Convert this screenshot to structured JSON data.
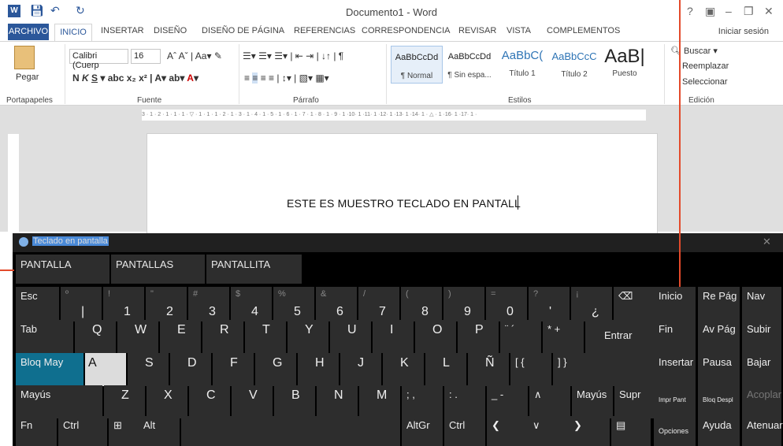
{
  "titlebar": {
    "document_title": "Documento1 - Word",
    "controls": [
      "?",
      "▣",
      "–",
      "❐",
      "✕"
    ]
  },
  "tabs": {
    "archivo": "ARCHIVO",
    "inicio": "INICIO",
    "items": [
      "INSERTAR",
      "DISEÑO",
      "DISEÑO DE PÁGINA",
      "REFERENCIAS",
      "CORRESPONDENCIA",
      "REVISAR",
      "VISTA",
      "COMPLEMENTOS"
    ],
    "signin": "Iniciar sesión"
  },
  "ribbon": {
    "paste_label": "Pegar",
    "font_name": "Calibri (Cuerp",
    "font_size": "16",
    "groups": [
      "Portapapeles",
      "Fuente",
      "Párrafo",
      "Estilos",
      "Edición"
    ],
    "styles": [
      {
        "sample": "AaBbCcDd",
        "name": "¶ Normal"
      },
      {
        "sample": "AaBbCcDd",
        "name": "¶ Sin espa..."
      },
      {
        "sample": "AaBbC(",
        "name": "Título 1"
      },
      {
        "sample": "AaBbCcC",
        "name": "Título 2"
      },
      {
        "sample": "AaB|",
        "name": "Puesto"
      }
    ],
    "editing": [
      "Buscar",
      "Reemplazar",
      "Seleccionar"
    ]
  },
  "document": {
    "text": "ESTE ES MUESTRO TECLADO EN PANTALL"
  },
  "osk": {
    "title": "Teclado en pantalla",
    "suggestions": [
      "PANTALLA",
      "PANTALLAS",
      "PANTALLITA"
    ],
    "row1": [
      {
        "lab": "Esc"
      },
      {
        "alt": "º",
        "main": "|"
      },
      {
        "alt": "!",
        "main": "1"
      },
      {
        "alt": "\"",
        "main": "2"
      },
      {
        "alt": "#",
        "main": "3"
      },
      {
        "alt": "$",
        "main": "4"
      },
      {
        "alt": "%",
        "main": "5"
      },
      {
        "alt": "&",
        "main": "6"
      },
      {
        "alt": "/",
        "main": "7"
      },
      {
        "alt": "(",
        "main": "8"
      },
      {
        "alt": ")",
        "main": "9"
      },
      {
        "alt": "=",
        "main": "0"
      },
      {
        "alt": "?",
        "main": "'"
      },
      {
        "alt": "¡",
        "main": "¿"
      },
      {
        "lab": "⌫"
      }
    ],
    "row2": [
      "Tab",
      "Q",
      "W",
      "E",
      "R",
      "T",
      "Y",
      "U",
      "I",
      "O",
      "P",
      "¨ ´",
      "* +",
      "Entrar"
    ],
    "row3": [
      "Bloq May",
      "A",
      "S",
      "D",
      "F",
      "G",
      "H",
      "J",
      "K",
      "L",
      "Ñ",
      "[ {",
      "] }"
    ],
    "row4": [
      "Mayús",
      "Z",
      "X",
      "C",
      "V",
      "B",
      "N",
      "M",
      "; ,",
      ": .",
      "_ -",
      "∧",
      "Mayús",
      "Supr"
    ],
    "row5": [
      "Fn",
      "Ctrl",
      "⊞",
      "Alt",
      "AltGr",
      "Ctrl",
      "❮",
      "∨",
      "❯",
      "▤"
    ],
    "nav": [
      [
        "Inicio",
        "Re Pág",
        "Nav"
      ],
      [
        "Fin",
        "Av Pág",
        "Subir"
      ],
      [
        "Insertar",
        "Pausa",
        "Bajar"
      ],
      [
        "Impr Pant",
        "Bloq Despl",
        "Acoplar"
      ],
      [
        "Opciones",
        "Ayuda",
        "Atenuar"
      ]
    ]
  },
  "colors": {
    "word_blue": "#2b579a",
    "key_bg": "#2d2d2d",
    "active_key": "#0f6f8f",
    "callout": "#e34a2b"
  }
}
